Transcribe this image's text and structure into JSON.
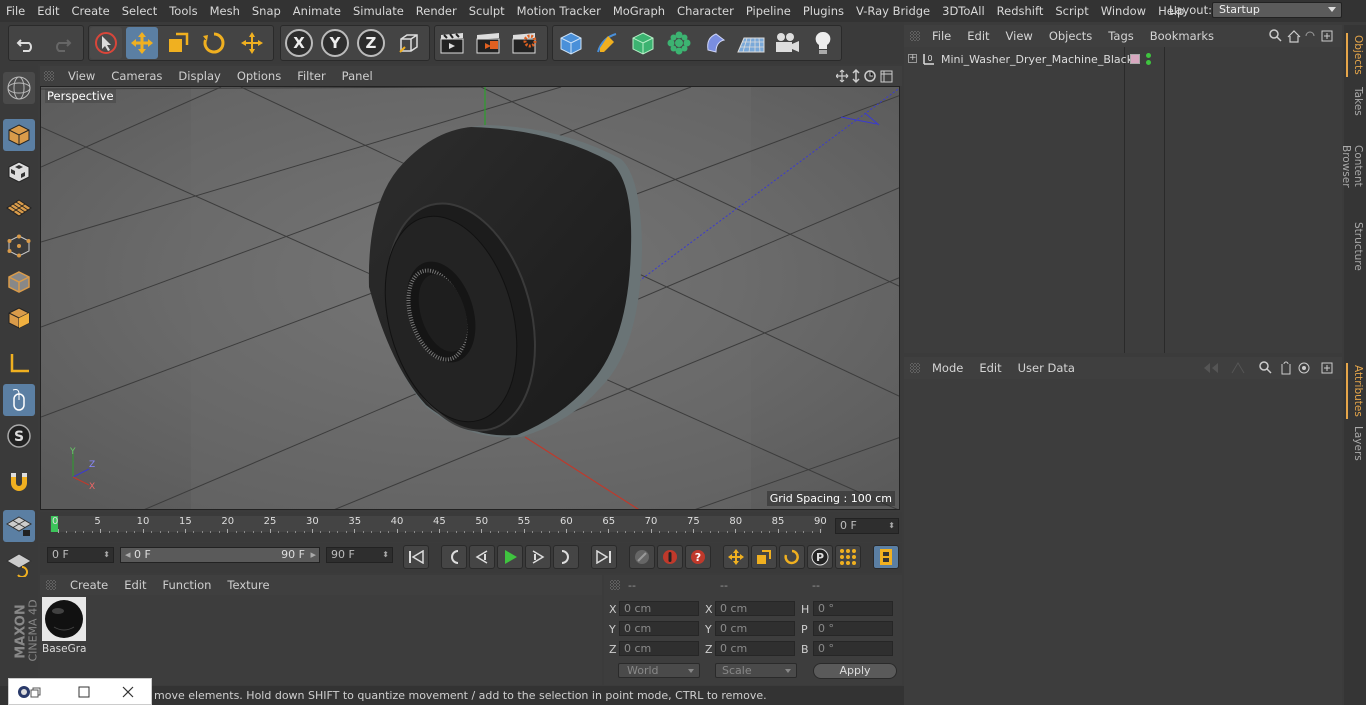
{
  "menubar": {
    "items": [
      "File",
      "Edit",
      "Create",
      "Select",
      "Tools",
      "Mesh",
      "Snap",
      "Animate",
      "Simulate",
      "Render",
      "Sculpt",
      "Motion Tracker",
      "MoGraph",
      "Character",
      "Pipeline",
      "Plugins",
      "V-Ray Bridge",
      "3DToAll",
      "Redshift",
      "Script",
      "Window",
      "Help"
    ],
    "layout_label": "Layout:",
    "layout_value": "Startup"
  },
  "toolbar": {
    "axis_x": "X",
    "axis_y": "Y",
    "axis_z": "Z"
  },
  "viewport": {
    "menu": [
      "View",
      "Cameras",
      "Display",
      "Options",
      "Filter",
      "Panel"
    ],
    "label": "Perspective",
    "grid_spacing": "Grid Spacing : 100 cm",
    "axis_labels": {
      "y": "Y",
      "z": "Z",
      "x": "X"
    }
  },
  "timeline": {
    "ticks": [
      "0",
      "5",
      "10",
      "15",
      "20",
      "25",
      "30",
      "35",
      "40",
      "45",
      "50",
      "55",
      "60",
      "65",
      "70",
      "75",
      "80",
      "85",
      "90"
    ],
    "current_frame": "0 F"
  },
  "transport": {
    "start_field": "0 F",
    "range_start": "0 F",
    "range_end": "90 F",
    "end_field": "90 F"
  },
  "material": {
    "menu": [
      "Create",
      "Edit",
      "Function",
      "Texture"
    ],
    "items": [
      {
        "name": "BaseGra"
      }
    ]
  },
  "coordinates": {
    "headers": [
      "--",
      "--",
      "--"
    ],
    "rows": [
      {
        "l1": "X",
        "v1": "0 cm",
        "l2": "X",
        "v2": "0 cm",
        "l3": "H",
        "v3": "0 °"
      },
      {
        "l1": "Y",
        "v1": "0 cm",
        "l2": "Y",
        "v2": "0 cm",
        "l3": "P",
        "v3": "0 °"
      },
      {
        "l1": "Z",
        "v1": "0 cm",
        "l2": "Z",
        "v2": "0 cm",
        "l3": "B",
        "v3": "0 °"
      }
    ],
    "world_label": "World",
    "scale_label": "Scale",
    "apply_label": "Apply"
  },
  "status": {
    "text": "move elements. Hold down SHIFT to quantize movement / add to the selection in point mode, CTRL to remove."
  },
  "objects": {
    "menu": [
      "File",
      "Edit",
      "View",
      "Objects",
      "Tags",
      "Bookmarks"
    ],
    "items": [
      {
        "name": "Mini_Washer_Dryer_Machine_Black"
      }
    ]
  },
  "attributes": {
    "menu": [
      "Mode",
      "Edit",
      "User Data"
    ]
  },
  "right_tabs": {
    "objects": "Objects",
    "takes": "Takes",
    "content_browser": "Content Browser",
    "structure": "Structure",
    "attributes": "Attributes",
    "layers": "Layers"
  },
  "brand": {
    "maxon": "MAXON",
    "product": "CINEMA 4D"
  },
  "colors": {
    "accent": "#5b7fa3",
    "active_tab": "#e6a64a",
    "play": "#3fc43f"
  }
}
